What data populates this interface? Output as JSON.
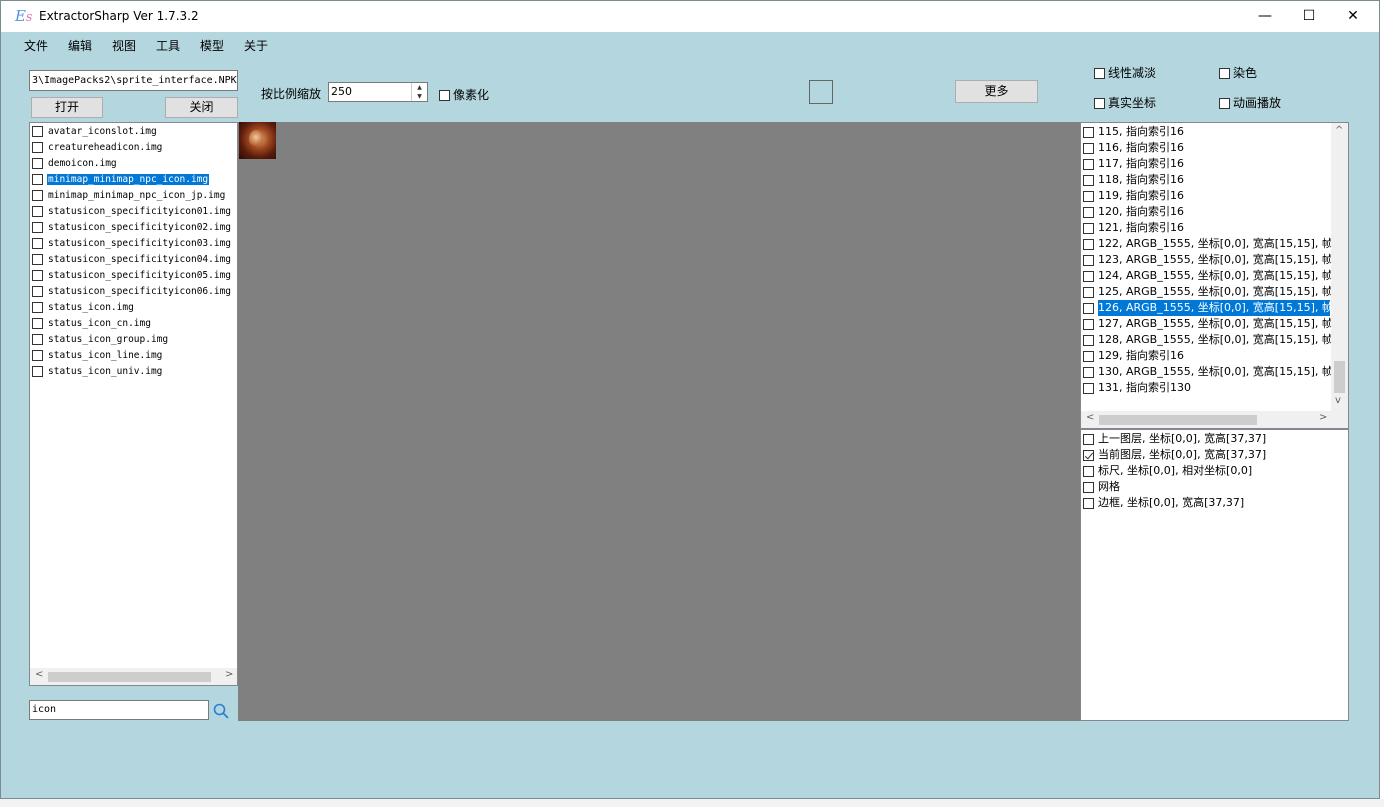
{
  "window": {
    "title": "ExtractorSharp Ver 1.7.3.2",
    "icon": "ExtractorSharp-logo-icon",
    "controls": {
      "minimize": "—",
      "maximize": "☐",
      "close": "✕"
    }
  },
  "menu": [
    "文件",
    "编辑",
    "视图",
    "工具",
    "模型",
    "关于"
  ],
  "file_panel": {
    "path": "3\\ImagePacks2\\sprite_interface.NPK",
    "open_label": "打开",
    "close_label": "关闭",
    "files": [
      "avatar_iconslot.img",
      "creatureheadicon.img",
      "demoicon.img",
      "minimap_minimap_npc_icon.img",
      "minimap_minimap_npc_icon_jp.img",
      "statusicon_specificityicon01.img",
      "statusicon_specificityicon02.img",
      "statusicon_specificityicon03.img",
      "statusicon_specificityicon04.img",
      "statusicon_specificityicon05.img",
      "statusicon_specificityicon06.img",
      "status_icon.img",
      "status_icon_cn.img",
      "status_icon_group.img",
      "status_icon_line.img",
      "status_icon_univ.img"
    ],
    "selected_index": 3,
    "search_value": "icon"
  },
  "toolbar": {
    "scale_label": "按比例缩放",
    "scale_value": "250",
    "pixelate_label": "像素化",
    "more_label": "更多",
    "linear_fade_label": "线性减淡",
    "dye_label": "染色",
    "real_coords_label": "真实坐标",
    "animation_label": "动画播放"
  },
  "frames": {
    "items": [
      "115, 指向索引16",
      "116, 指向索引16",
      "117, 指向索引16",
      "118, 指向索引16",
      "119, 指向索引16",
      "120, 指向索引16",
      "121, 指向索引16",
      "122, ARGB_1555, 坐标[0,0], 宽高[15,15], 帧",
      "123, ARGB_1555, 坐标[0,0], 宽高[15,15], 帧",
      "124, ARGB_1555, 坐标[0,0], 宽高[15,15], 帧",
      "125, ARGB_1555, 坐标[0,0], 宽高[15,15], 帧",
      "126, ARGB_1555, 坐标[0,0], 宽高[15,15], 帧",
      "127, ARGB_1555, 坐标[0,0], 宽高[15,15], 帧",
      "128, ARGB_1555, 坐标[0,0], 宽高[15,15], 帧",
      "129, 指向索引16",
      "130, ARGB_1555, 坐标[0,0], 宽高[15,15], 帧",
      "131, 指向索引130"
    ],
    "selected_index": 11
  },
  "layers": [
    {
      "label": "上一图层, 坐标[0,0], 宽高[37,37]",
      "checked": false
    },
    {
      "label": "当前图层, 坐标[0,0], 宽高[37,37]",
      "checked": true
    },
    {
      "label": "标尺, 坐标[0,0], 相对坐标[0,0]",
      "checked": false
    },
    {
      "label": "网格",
      "checked": false
    },
    {
      "label": "边框, 坐标[0,0], 宽高[37,37]",
      "checked": false
    }
  ]
}
